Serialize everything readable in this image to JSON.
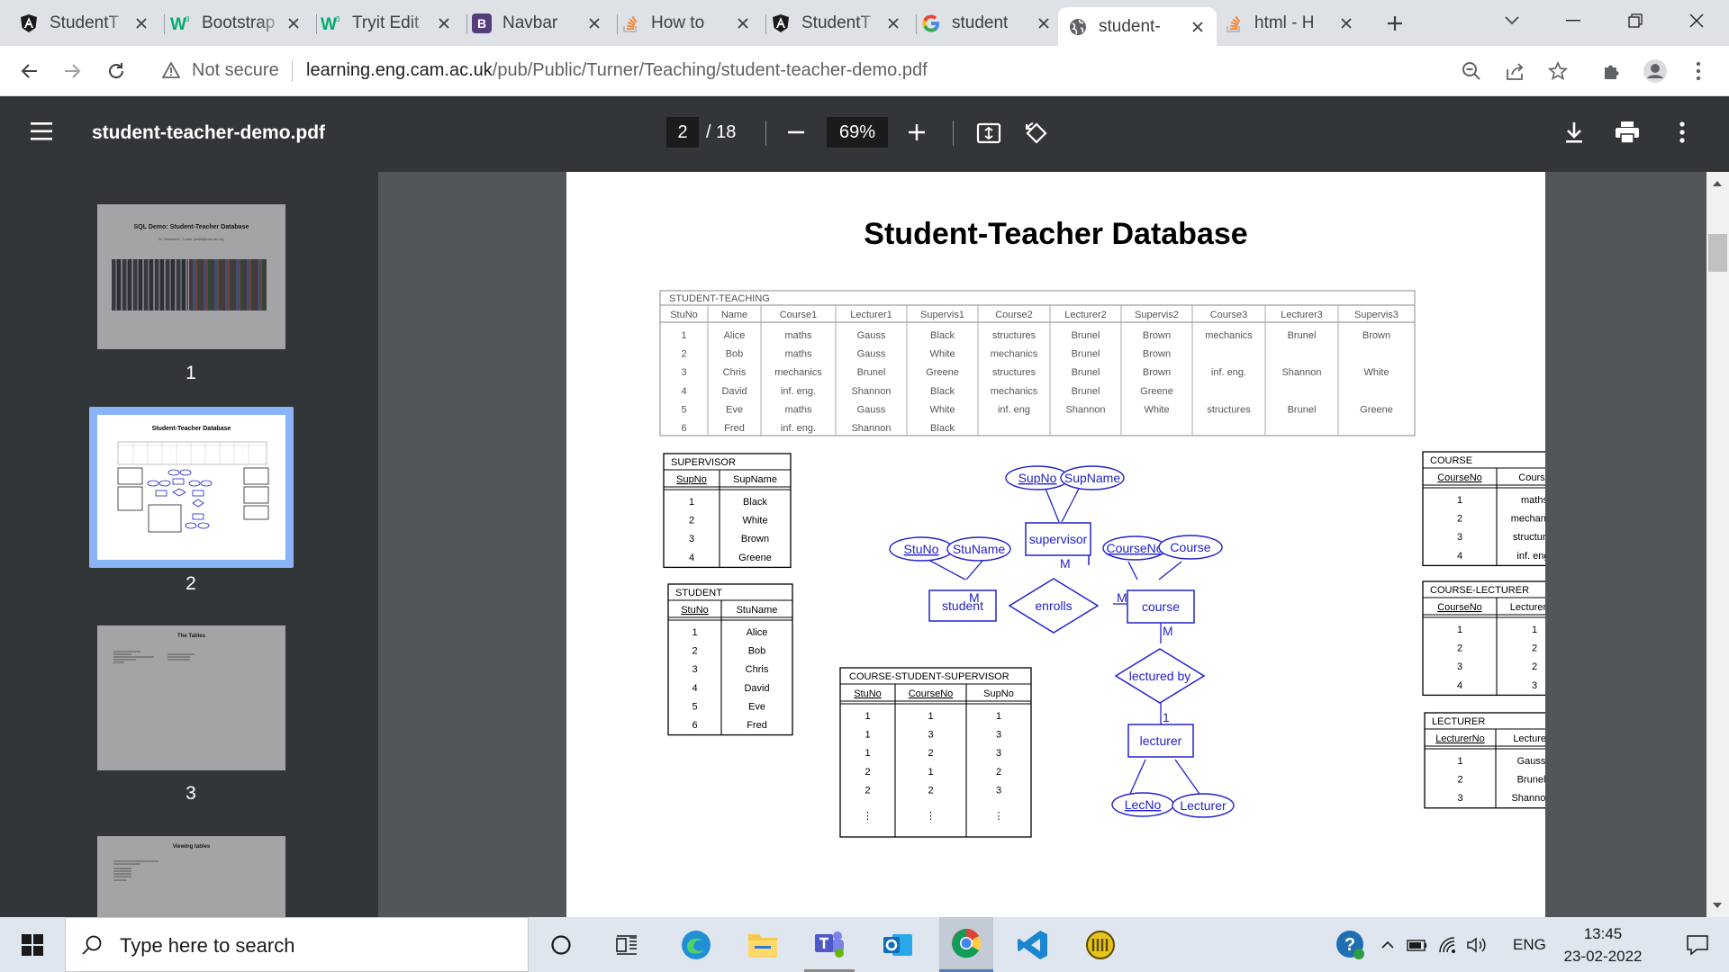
{
  "browser": {
    "tabs": [
      {
        "title": "StudentT",
        "icon": "angular-icon"
      },
      {
        "title": "Bootstrap",
        "icon": "w3schools-icon"
      },
      {
        "title": "Tryit Edit",
        "icon": "w3schools-icon"
      },
      {
        "title": "Navbar",
        "icon": "bootstrap-icon"
      },
      {
        "title": "How to",
        "icon": "stackoverflow-icon"
      },
      {
        "title": "StudentT",
        "icon": "angular-icon"
      },
      {
        "title": "student",
        "icon": "google-icon"
      },
      {
        "title": "student-",
        "icon": "globe-icon",
        "active": true
      },
      {
        "title": "html - H",
        "icon": "stackoverflow-icon"
      }
    ],
    "security": "Not secure",
    "url_host": "learning.eng.cam.ac.uk",
    "url_path": "/pub/Public/Turner/Teaching/student-teacher-demo.pdf"
  },
  "pdf": {
    "filename": "student-teacher-demo.pdf",
    "current_page": "2",
    "total_pages": "/ 18",
    "zoom": "69%",
    "thumbnails": [
      {
        "number": "1",
        "title": "SQL Demo: Student-Teacher Database",
        "subtitle": "Dr. Richard E. Turner (ret26@cam.ac.uk)"
      },
      {
        "number": "2",
        "title": "Student-Teacher Database"
      },
      {
        "number": "3",
        "title": "The Tables"
      },
      {
        "number": "4",
        "title": "Viewing tables"
      }
    ]
  },
  "document": {
    "title": "Student-Teacher Database",
    "student_teaching": {
      "caption": "STUDENT-TEACHING",
      "headers": [
        "StuNo",
        "Name",
        "Course1",
        "Lecturer1",
        "Supervis1",
        "Course2",
        "Lecturer2",
        "Supervis2",
        "Course3",
        "Lecturer3",
        "Supervis3"
      ],
      "rows": [
        [
          "1",
          "Alice",
          "maths",
          "Gauss",
          "Black",
          "structures",
          "Brunel",
          "Brown",
          "mechanics",
          "Brunel",
          "Brown"
        ],
        [
          "2",
          "Bob",
          "maths",
          "Gauss",
          "White",
          "mechanics",
          "Brunel",
          "Brown",
          "",
          "",
          ""
        ],
        [
          "3",
          "Chris",
          "mechanics",
          "Brunel",
          "Greene",
          "structures",
          "Brunel",
          "Brown",
          "inf. eng.",
          "Shannon",
          "White"
        ],
        [
          "4",
          "David",
          "inf. eng.",
          "Shannon",
          "Black",
          "mechanics",
          "Brunel",
          "Greene",
          "",
          "",
          ""
        ],
        [
          "5",
          "Eve",
          "maths",
          "Gauss",
          "White",
          "inf. eng",
          "Shannon",
          "White",
          "structures",
          "Brunel",
          "Greene"
        ],
        [
          "6",
          "Fred",
          "inf. eng.",
          "Shannon",
          "Black",
          "",
          "",
          "",
          "",
          "",
          ""
        ]
      ]
    },
    "supervisor": {
      "caption": "SUPERVISOR",
      "headers": [
        "SupNo",
        "SupName"
      ],
      "rows": [
        [
          "1",
          "Black"
        ],
        [
          "2",
          "White"
        ],
        [
          "3",
          "Brown"
        ],
        [
          "4",
          "Greene"
        ]
      ]
    },
    "student": {
      "caption": "STUDENT",
      "headers": [
        "StuNo",
        "StuName"
      ],
      "rows": [
        [
          "1",
          "Alice"
        ],
        [
          "2",
          "Bob"
        ],
        [
          "3",
          "Chris"
        ],
        [
          "4",
          "David"
        ],
        [
          "5",
          "Eve"
        ],
        [
          "6",
          "Fred"
        ]
      ]
    },
    "course_student_supervisor": {
      "caption": "COURSE-STUDENT-SUPERVISOR",
      "headers": [
        "StuNo",
        "CourseNo",
        "SupNo"
      ],
      "rows": [
        [
          "1",
          "1",
          "1"
        ],
        [
          "1",
          "3",
          "3"
        ],
        [
          "1",
          "2",
          "3"
        ],
        [
          "2",
          "1",
          "2"
        ],
        [
          "2",
          "2",
          "3"
        ],
        [
          "⋮",
          "⋮",
          "⋮"
        ]
      ]
    },
    "course": {
      "caption": "COURSE",
      "headers": [
        "CourseNo",
        "Course"
      ],
      "rows": [
        [
          "1",
          "maths"
        ],
        [
          "2",
          "mechanics"
        ],
        [
          "3",
          "structures"
        ],
        [
          "4",
          "inf. eng."
        ]
      ]
    },
    "course_lecturer": {
      "caption": "COURSE-LECTURER",
      "headers": [
        "CourseNo",
        "LecturerNo"
      ],
      "rows": [
        [
          "1",
          "1"
        ],
        [
          "2",
          "2"
        ],
        [
          "3",
          "2"
        ],
        [
          "4",
          "3"
        ]
      ]
    },
    "lecturer": {
      "caption": "LECTURER",
      "headers": [
        "LecturerNo",
        "Lecturer"
      ],
      "rows": [
        [
          "1",
          "Gauss"
        ],
        [
          "2",
          "Brunel"
        ],
        [
          "3",
          "Shannon"
        ]
      ]
    },
    "er": {
      "entities": {
        "supervisor": "supervisor",
        "student": "student",
        "course": "course",
        "lecturer": "lecturer"
      },
      "relations": {
        "enrolls": "enrolls",
        "lectured_by": "lectured by"
      },
      "attributes": {
        "supno": "SupNo",
        "supname": "SupName",
        "stuno": "StuNo",
        "stuname": "StuName",
        "courseno": "CourseNo",
        "course": "Course",
        "lecno": "LecNo",
        "lecturer": "Lecturer"
      },
      "cardinality": {
        "supervisor_enrolls": "M",
        "student_enrolls": "M",
        "course_enrolls": "M",
        "course_lectured": "M",
        "lecturer_lectured": "1"
      },
      "color": "#2222cc"
    }
  },
  "taskbar": {
    "search_placeholder": "Type here to search",
    "language": "ENG",
    "time": "13:45",
    "date": "23-02-2022"
  }
}
